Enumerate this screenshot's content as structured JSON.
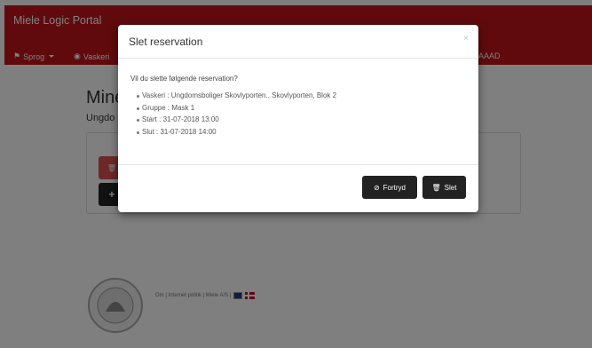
{
  "navbar": {
    "brand": "Miele Logic Portal",
    "language_label": "Sprog",
    "laundry_label": "Vaskeri",
    "user_label": "AAAD"
  },
  "page": {
    "title": "Mine",
    "subtitle": "Ungdo",
    "delete_glyph": "🗑",
    "add_glyph": "+"
  },
  "footer": {
    "links": "Om | Internet politik | Miele A/S |"
  },
  "modal": {
    "title": "Slet reservation",
    "close": "×",
    "question": "Vil du slette følgende reservation?",
    "details": [
      "Vaskeri : Ungdomsboliger Skovlyporten., Skovlyporten, Blok 2",
      "Gruppe : Mask 1",
      "Start : 31-07-2018 13:00",
      "Slut : 31-07-2018 14:00"
    ],
    "cancel_label": "Fortryd",
    "delete_label": "Slet"
  },
  "colors": {
    "navbar": "#c1141a",
    "button_dark": "#222222",
    "button_danger": "#d9534f"
  },
  "icons": {
    "flag": "flag-icon",
    "eye": "eye-icon",
    "ban": "ban-icon",
    "trash": "trash-icon"
  }
}
